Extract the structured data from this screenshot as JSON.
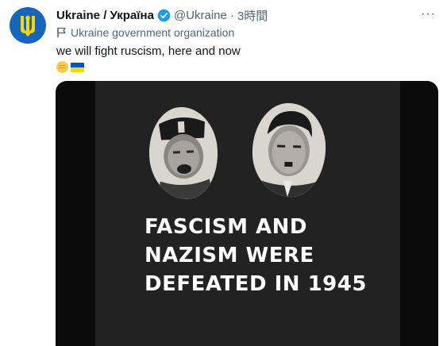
{
  "account": {
    "display_name": "Ukraine / Україна",
    "handle": "@Ukraine",
    "separator": "·",
    "time": "3時間",
    "affiliation": "Ukraine government organization"
  },
  "tweet": {
    "text": "we will fight ruscism, here and now",
    "emojis": [
      "raised-fist-emoji",
      "ukraine-flag-emoji"
    ]
  },
  "media": {
    "headline_lines": [
      "FASCISM AND",
      "NAZISM WERE",
      "DEFEATED IN 1945"
    ]
  },
  "icons": {
    "avatar": "trident-coat-of-arms-icon",
    "verified": "verified-badge-icon",
    "affiliation": "flag-icon",
    "more": "more-options-icon"
  },
  "colors": {
    "avatar_bg": "#1665bd",
    "trident": "#ffd500",
    "verified": "#1d9bf0",
    "secondary_text": "#536471",
    "media_bg": "#222222"
  }
}
